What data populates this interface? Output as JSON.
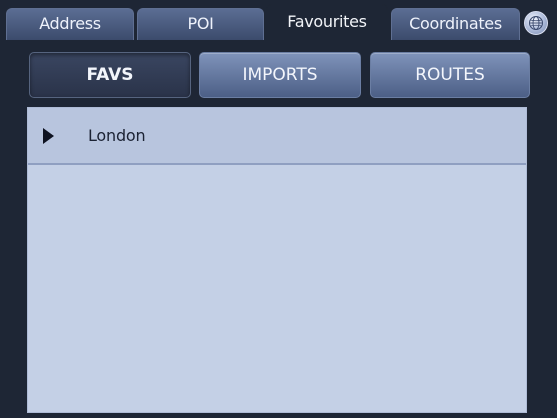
{
  "tabs": [
    {
      "label": "Address"
    },
    {
      "label": "POI"
    },
    {
      "label": "Favourites",
      "active": true
    },
    {
      "label": "Coordinates"
    }
  ],
  "globe_button": {
    "icon": "globe-icon"
  },
  "subtabs": [
    {
      "label": "FAVS",
      "selected": true
    },
    {
      "label": "IMPORTS"
    },
    {
      "label": "ROUTES"
    }
  ],
  "list": {
    "items": [
      {
        "label": "London",
        "icon": "play-arrow-icon"
      }
    ]
  },
  "colors": {
    "background": "#1e2635",
    "tab": "#4a5a7e",
    "button": "#6a7ea6",
    "list_bg": "#c4d0e6",
    "list_item_bg": "#b8c5de"
  }
}
